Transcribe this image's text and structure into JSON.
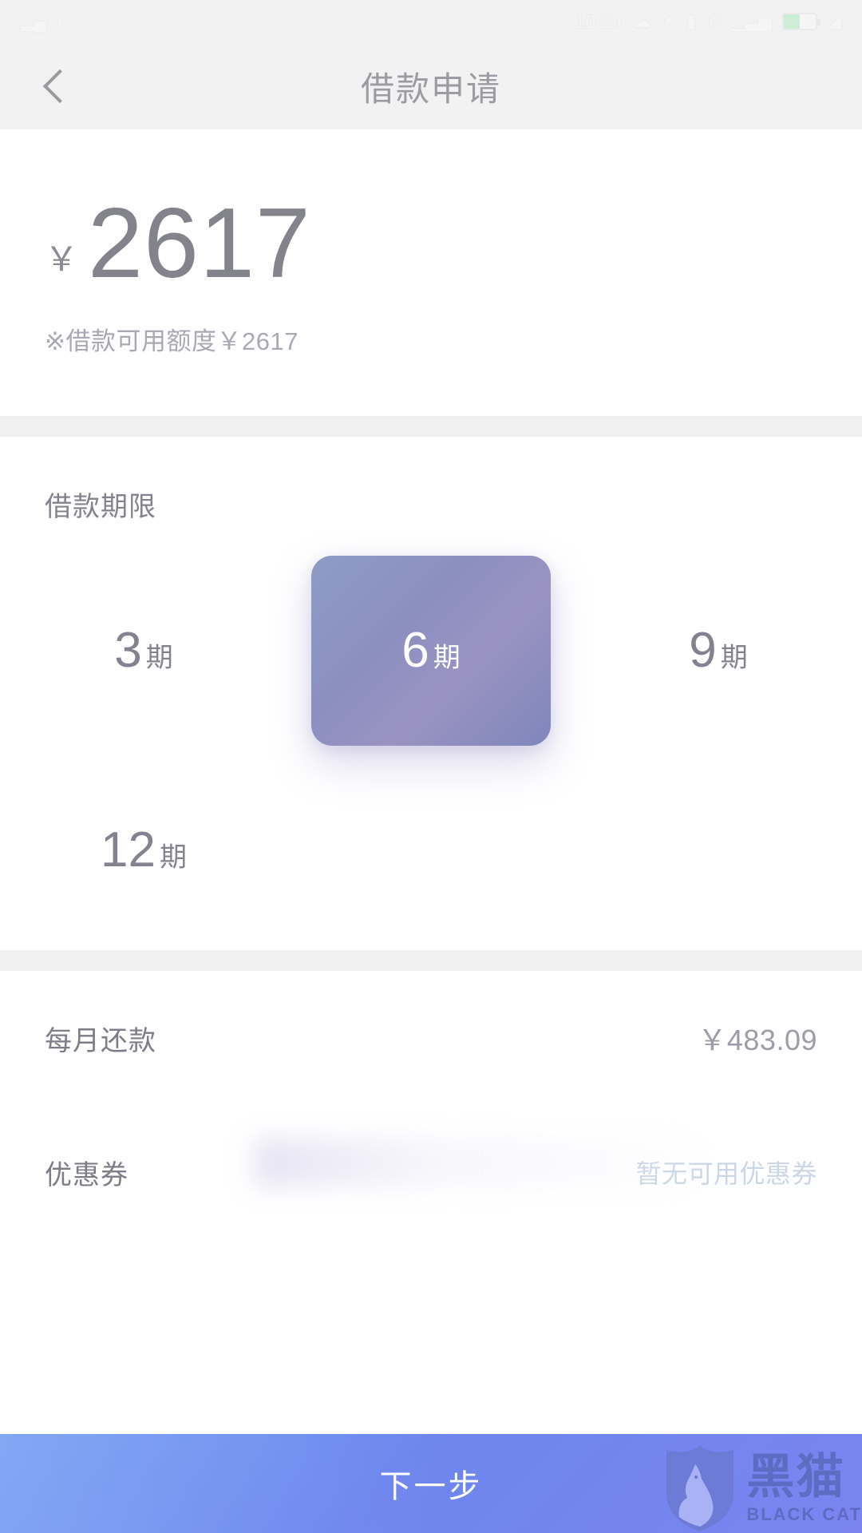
{
  "statusbar": {
    "time": "10:24",
    "left_icons": [
      "signal-icon",
      "wifi-icon"
    ],
    "right_icons": [
      "alarm-icon",
      "cloud-icon",
      "bluetooth-icon",
      "sim-icon",
      "phone-icon",
      "signal-bars-icon",
      "wifi-icon"
    ],
    "battery_percent": "50",
    "battery_color": "#7ee29a"
  },
  "header": {
    "title": "借款申请",
    "back_label": "返回"
  },
  "amount": {
    "currency_symbol": "￥",
    "value": "2617",
    "note": "※借款可用额度￥2617"
  },
  "terms": {
    "section_label": "借款期限",
    "selected_index": 1,
    "options": [
      {
        "num": "3",
        "unit": "期"
      },
      {
        "num": "6",
        "unit": "期"
      },
      {
        "num": "9",
        "unit": "期"
      },
      {
        "num": "12",
        "unit": "期"
      }
    ]
  },
  "details": {
    "rows": [
      {
        "label": "每月还款",
        "value": "￥483.09",
        "muted": false
      },
      {
        "label": "优惠券",
        "value": "暂无可用优惠券",
        "muted": true
      }
    ]
  },
  "cta": {
    "label": "下一步",
    "accent": "#6f8bf0"
  },
  "watermark": {
    "cn": "黑猫",
    "en": "BLACK CAT"
  }
}
